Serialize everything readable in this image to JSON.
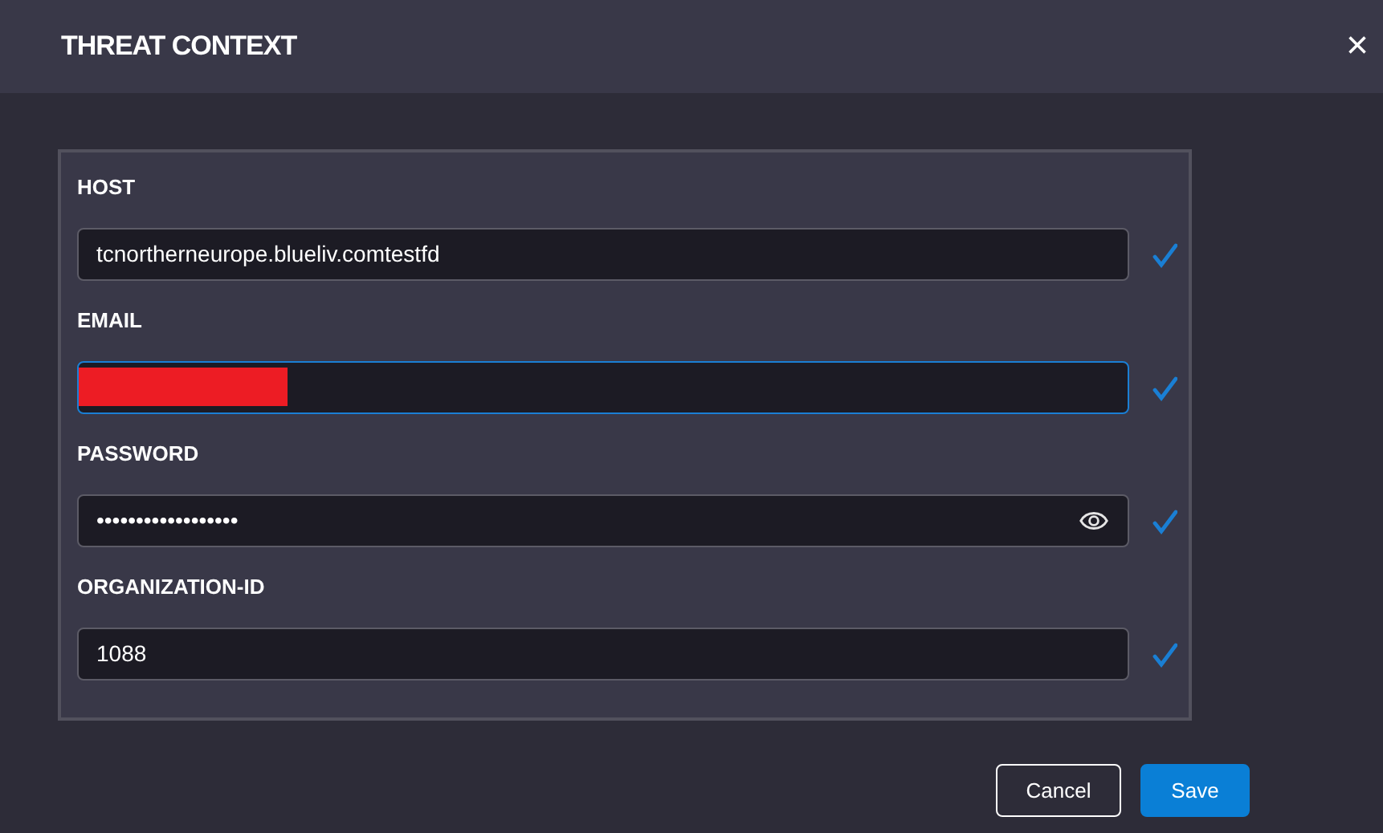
{
  "dialog": {
    "title": "THREAT CONTEXT",
    "close": "×"
  },
  "fields": [
    {
      "label": "HOST",
      "kind": "text",
      "value": "tcnortherneurope.blueliv.comtestfd",
      "focused": false,
      "redacted": false,
      "valid": true
    },
    {
      "label": "EMAIL",
      "kind": "text",
      "focused": true,
      "redacted": true,
      "valid": true
    },
    {
      "label": "PASSWORD",
      "kind": "password",
      "value": "••••••••••••••••••",
      "focused": false,
      "redacted": false,
      "valid": true
    },
    {
      "label": "ORGANIZATION-ID",
      "kind": "text",
      "value": "1088",
      "focused": false,
      "redacted": false,
      "valid": true
    }
  ],
  "buttons": [
    {
      "label": "Cancel",
      "kind": "secondary"
    },
    {
      "label": "Save",
      "kind": "primary"
    }
  ]
}
